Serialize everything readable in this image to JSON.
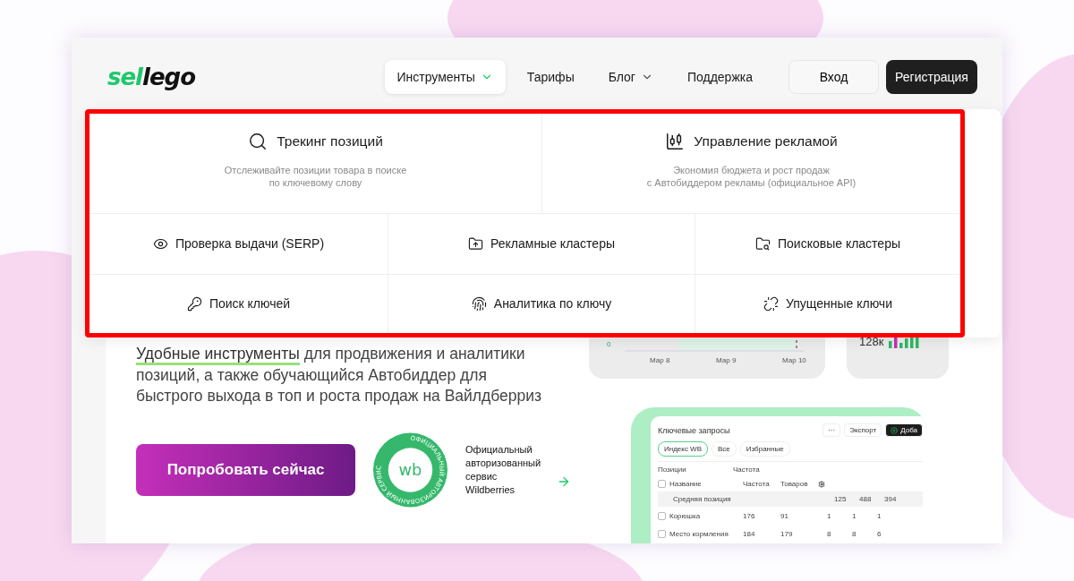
{
  "logo": "sellego",
  "nav": [
    {
      "label": "Инструменты",
      "has_menu": true,
      "selected": true
    },
    {
      "label": "Тарифы",
      "has_menu": false,
      "selected": false
    },
    {
      "label": "Блог",
      "has_menu": true,
      "selected": false
    },
    {
      "label": "Поддержка",
      "has_menu": false,
      "selected": false
    }
  ],
  "auth": {
    "login": "Вход",
    "register": "Регистрация"
  },
  "menu": {
    "featured": [
      {
        "title": "Трекинг позиций",
        "description": "Отслеживайте позиции товара в поиске\nпо ключевому слову"
      },
      {
        "title": "Управление рекламой",
        "description": "Экономия бюджета и рост продаж\nс Автобиддером рекламы (официальное API)"
      }
    ],
    "items": [
      {
        "label": "Проверка выдачи (SERP)"
      },
      {
        "label": "Рекламные кластеры"
      },
      {
        "label": "Поисковые кластеры"
      },
      {
        "label": "Поиск ключей"
      },
      {
        "label": "Аналитика по ключу"
      },
      {
        "label": "Упущенные ключи"
      }
    ]
  },
  "hero": {
    "highlight": "Удобные инструменты",
    "text": " для продвижения и аналитики позиций, а также обучающийся Автобиддер для быстрого выхода в топ и роста продаж на Вайлдберриз",
    "cta": "Попробовать сейчас",
    "seal_text": "wb",
    "seal_ring": "ОФИЦИАЛЬНЫЙ АВТОРИЗОВАННЫЙ СЕРВИС",
    "seal_caption": "Официальный\nавторизованный\nсервис Wildberries"
  },
  "chart_card": {
    "y_label": "0",
    "x_labels": [
      "Мар 8",
      "Мар 9",
      "Мар 10"
    ]
  },
  "stat_card": {
    "value": "128к"
  },
  "preview": {
    "title": "Ключевые запросы",
    "more": "···",
    "export": "Экспорт",
    "add": "Доба",
    "filters": [
      {
        "label": "Индекс WB",
        "selected": true
      },
      {
        "label": "Все",
        "selected": false
      },
      {
        "label": "Избранные",
        "selected": false
      }
    ],
    "filter_bar": [
      "Позиции",
      "Частота"
    ],
    "all_checked": false,
    "columns": [
      "Название",
      "Частота",
      "Товаров"
    ],
    "avg": {
      "label": "Средняя позиция",
      "values": [
        "125",
        "488",
        "394"
      ]
    },
    "rows": [
      {
        "name": "Корюшка",
        "checked": false,
        "freq": "176",
        "goods": "91",
        "values": [
          "1",
          "1",
          "1"
        ]
      },
      {
        "name": "Место кормления",
        "checked": false,
        "freq": "184",
        "goods": "179",
        "values": [
          "8",
          "8",
          "6"
        ]
      }
    ]
  }
}
